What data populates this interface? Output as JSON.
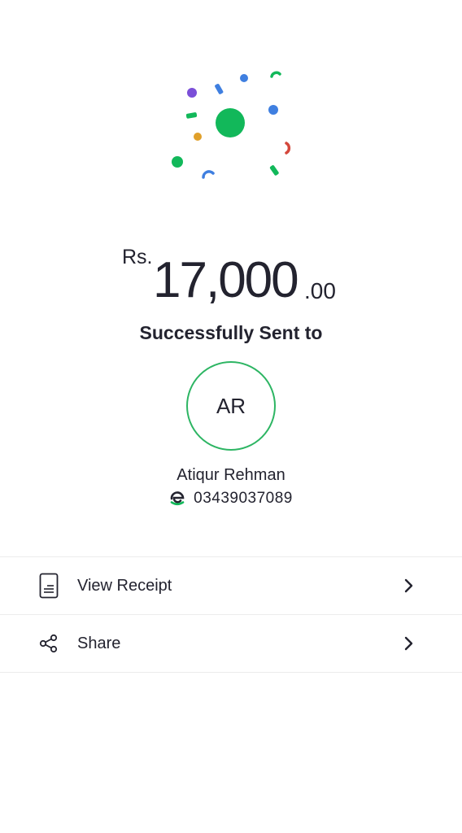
{
  "colors": {
    "accent": "#1db954",
    "text": "#23232f",
    "divider": "#ececec"
  },
  "transfer": {
    "currency": "Rs.",
    "amount": "17,000",
    "decimals": ".00",
    "status": "Successfully Sent to"
  },
  "recipient": {
    "initials": "AR",
    "name": "Atiqur Rehman",
    "wallet_icon": "easypaisa-wallet-icon",
    "phone": "03439037089"
  },
  "actions": [
    {
      "label": "View Receipt",
      "icon": "receipt-icon"
    },
    {
      "label": "Share",
      "icon": "share-icon"
    }
  ]
}
